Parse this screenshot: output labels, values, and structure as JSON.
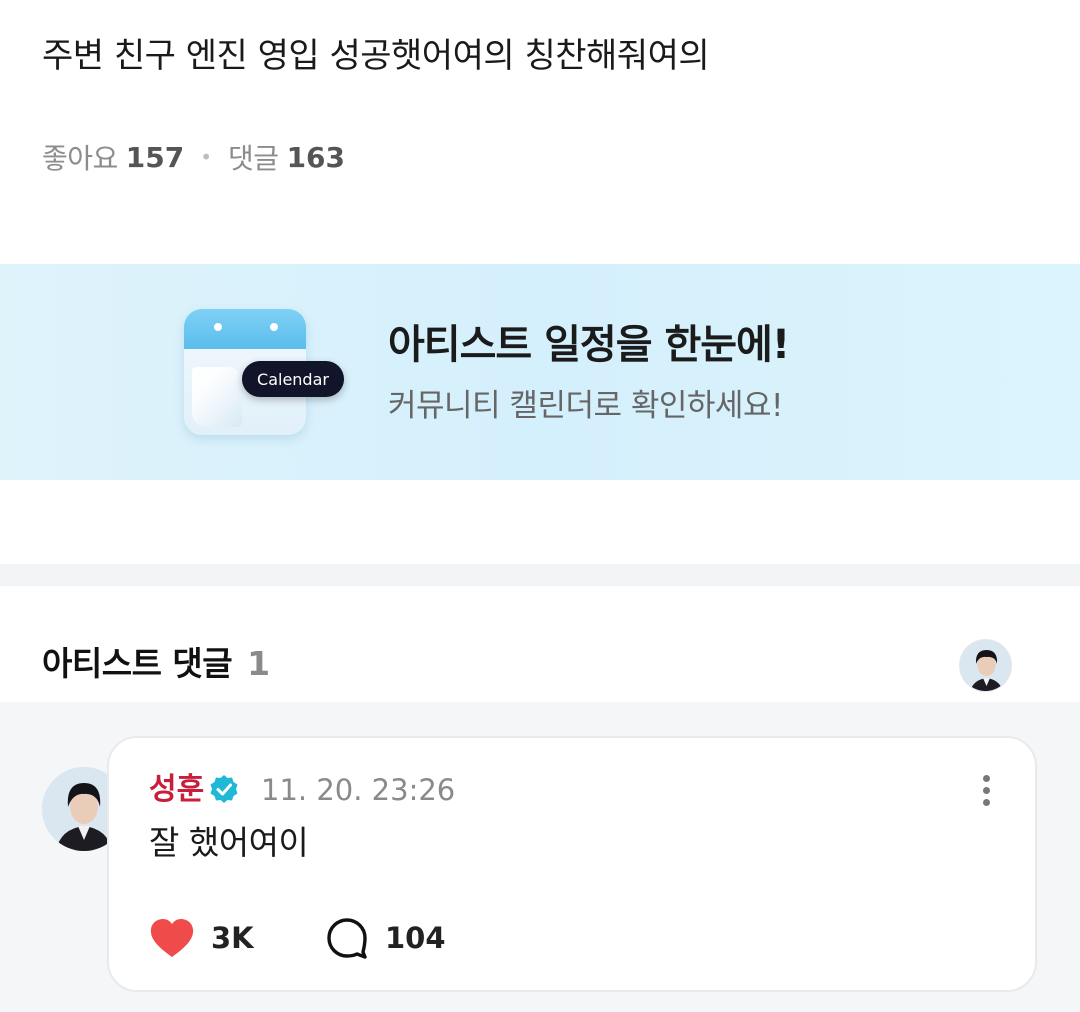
{
  "post": {
    "title": "주변 친구 엔진 영입 성공햇어여의 칭찬해줘여의",
    "likes_label": "좋아요",
    "likes_count": "157",
    "comments_label": "댓글",
    "comments_count": "163"
  },
  "banner": {
    "calendar_tag": "Calendar",
    "title": "아티스트 일정을 한눈에!",
    "subtitle": "커뮤니티 캘린더로 확인하세요!",
    "colors": {
      "background": "#d9f2fc",
      "calendar_header": "#5bbdec",
      "tag": "#12152a"
    }
  },
  "artist_comments": {
    "title": "아티스트 댓글",
    "count": "1"
  },
  "comment": {
    "author": "성훈",
    "timestamp": "11. 20. 23:26",
    "text": "잘 했어여이",
    "likes": "3K",
    "replies": "104",
    "icons": [
      "verified-badge-icon",
      "more-vert-icon",
      "heart-icon",
      "speech-bubble-icon"
    ],
    "colors": {
      "author": "#c81e3c",
      "verified": "#1fb8d6",
      "heart": "#ef4b4b"
    }
  }
}
